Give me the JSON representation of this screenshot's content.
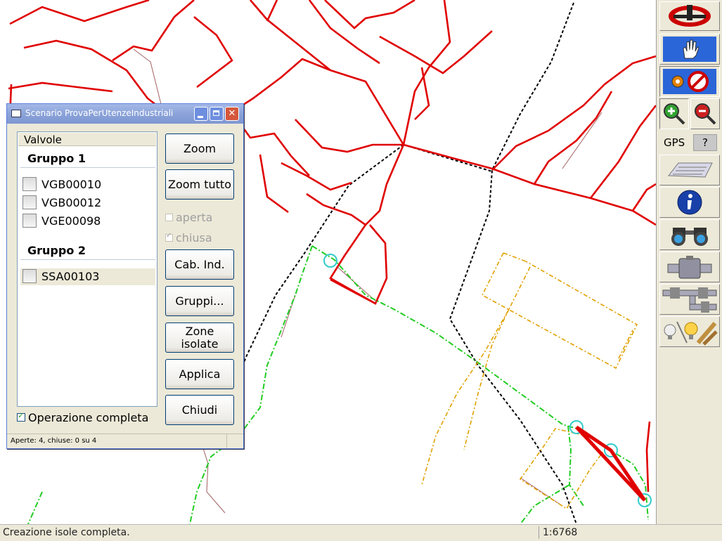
{
  "dialog": {
    "title": "Scenario ProvaPerUtenzeIndustriali",
    "list_header": "Valvole",
    "groups": [
      {
        "label": "Gruppo 1",
        "items": [
          "VGB00010",
          "VGB00012",
          "VGE00098"
        ]
      },
      {
        "label": "Gruppo 2",
        "items": [
          "SSA00103"
        ]
      }
    ],
    "buttons": {
      "zoom": "Zoom",
      "zoom_all": "Zoom tutto",
      "cab_ind": "Cab. Ind.",
      "groups": "Gruppi...",
      "isolated_zones": "Zone isolate",
      "apply": "Applica",
      "close": "Chiudi"
    },
    "checks": {
      "open": "aperta",
      "open_checked": false,
      "closed": "chiusa",
      "closed_checked": true
    },
    "complete_op": {
      "label": "Operazione completa",
      "checked": true
    },
    "status": "Aperte: 4, chiuse: 0 su 4"
  },
  "toolbar": {
    "gps_label": "GPS",
    "gps_button": "?",
    "icons": [
      "logo-icon",
      "hand-icon",
      "settings-disabled-icon",
      "zoom-in-icon",
      "zoom-out-icon",
      "keyboard-icon",
      "info-icon",
      "binoculars-icon",
      "pipe-icon",
      "pipe-network-icon",
      "lightbulb-icon"
    ]
  },
  "statusbar": {
    "message": "Creazione isole completa.",
    "scale": "1:6768"
  },
  "colors": {
    "pipe_red": "#e00000",
    "pipe_green": "#22cc22",
    "pipe_orange": "#e0a000",
    "boundary_black": "#000000",
    "marker_cyan": "#33cccc"
  }
}
